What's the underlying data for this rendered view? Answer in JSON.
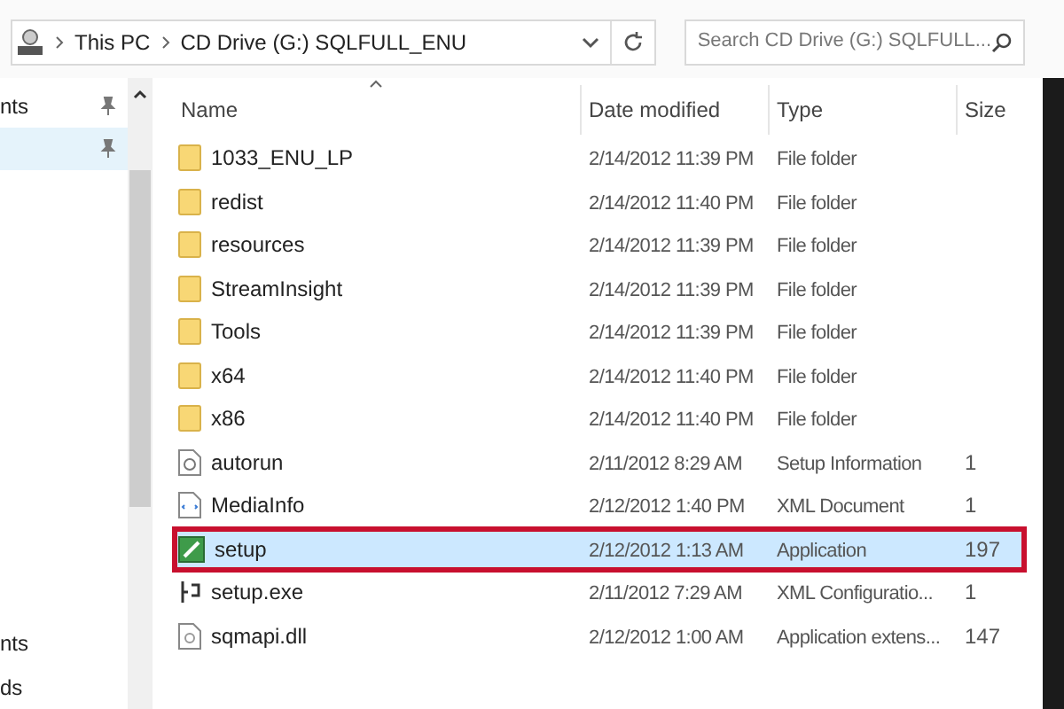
{
  "address_bar": {
    "crumbs": [
      "This PC",
      "CD Drive (G:) SQLFULL_ENU"
    ]
  },
  "search": {
    "placeholder": "Search CD Drive (G:) SQLFULL..."
  },
  "sidebar": {
    "items": [
      {
        "label": "nts",
        "pinned": true,
        "selected": false
      },
      {
        "pinned": true,
        "selected": true
      },
      {
        "label": "nts",
        "pinned": false,
        "selected": false
      },
      {
        "label": "ds",
        "pinned": false,
        "selected": false
      }
    ]
  },
  "table": {
    "columns": [
      "Name",
      "Date modified",
      "Type",
      "Size"
    ],
    "rows": [
      {
        "kind": "folder",
        "name": "1033_ENU_LP",
        "date": "2/14/2012 11:39 PM",
        "type": "File folder",
        "size": "",
        "selected": false
      },
      {
        "kind": "folder",
        "name": "redist",
        "date": "2/14/2012 11:40 PM",
        "type": "File folder",
        "size": "",
        "selected": false
      },
      {
        "kind": "folder",
        "name": "resources",
        "date": "2/14/2012 11:39 PM",
        "type": "File folder",
        "size": "",
        "selected": false
      },
      {
        "kind": "folder",
        "name": "StreamInsight",
        "date": "2/14/2012 11:39 PM",
        "type": "File folder",
        "size": "",
        "selected": false
      },
      {
        "kind": "folder",
        "name": "Tools",
        "date": "2/14/2012 11:39 PM",
        "type": "File folder",
        "size": "",
        "selected": false
      },
      {
        "kind": "folder",
        "name": "x64",
        "date": "2/14/2012 11:40 PM",
        "type": "File folder",
        "size": "",
        "selected": false
      },
      {
        "kind": "folder",
        "name": "x86",
        "date": "2/14/2012 11:40 PM",
        "type": "File folder",
        "size": "",
        "selected": false
      },
      {
        "kind": "settings",
        "name": "autorun",
        "date": "2/11/2012 8:29 AM",
        "type": "Setup Information",
        "size": "1",
        "selected": false
      },
      {
        "kind": "xml",
        "name": "MediaInfo",
        "date": "2/12/2012 1:40 PM",
        "type": "XML Document",
        "size": "1",
        "selected": false
      },
      {
        "kind": "app",
        "name": "setup",
        "date": "2/12/2012 1:13 AM",
        "type": "Application",
        "size": "197",
        "selected": true
      },
      {
        "kind": "config",
        "name": "setup.exe",
        "date": "2/11/2012 7:29 AM",
        "type": "XML Configuratio...",
        "size": "1",
        "selected": false
      },
      {
        "kind": "dll",
        "name": "sqmapi.dll",
        "date": "2/12/2012 1:00 AM",
        "type": "Application extens...",
        "size": "147",
        "selected": false
      }
    ]
  }
}
